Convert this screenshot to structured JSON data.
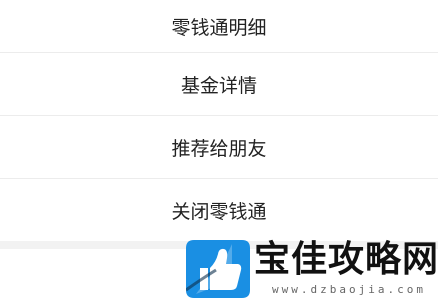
{
  "menu": {
    "items": [
      {
        "label": "零钱通明细"
      },
      {
        "label": "基金详情"
      },
      {
        "label": "推荐给朋友"
      },
      {
        "label": "关闭零钱通"
      }
    ]
  },
  "watermark": {
    "title": "宝佳攻略网",
    "url": "www.dzbaojia.com",
    "logo_icon": "thumbs-up-icon",
    "colors": {
      "logo": "#1a8fe3",
      "logo_dark": "#0b2f4d"
    }
  }
}
